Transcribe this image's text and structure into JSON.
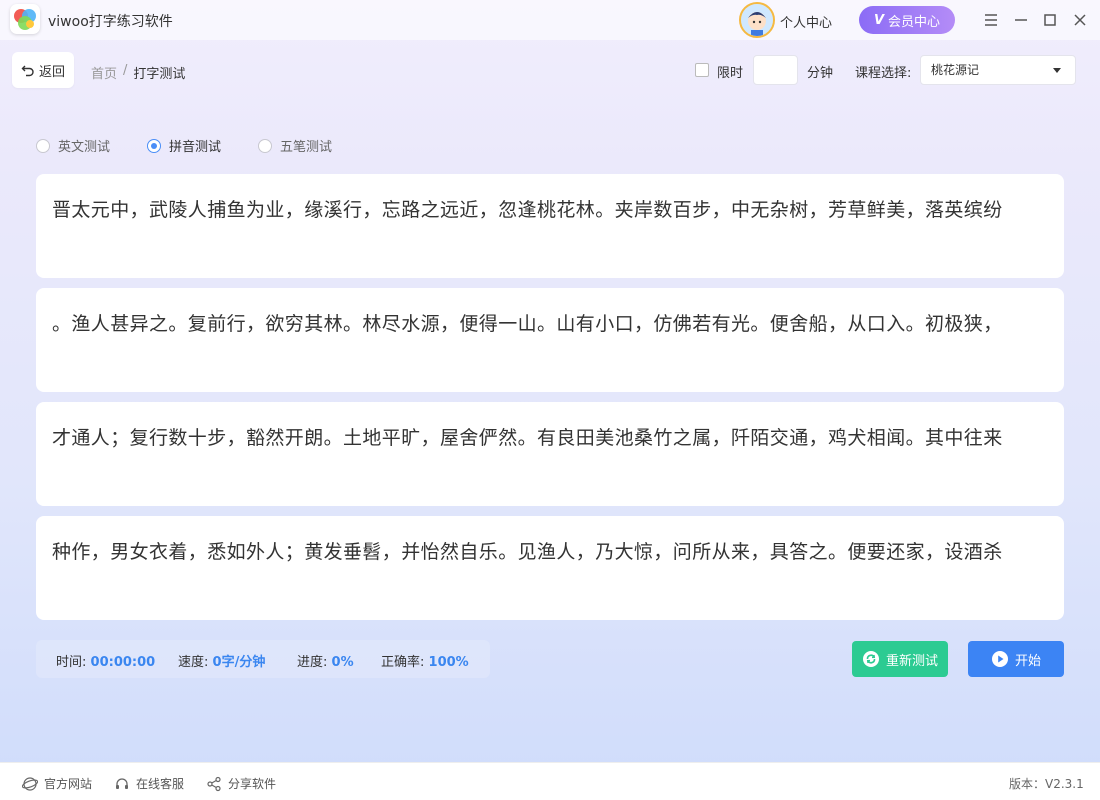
{
  "app": {
    "title": "viwoo打字练习软件",
    "personal_center": "个人中心",
    "vip_badge": "V",
    "vip_label": "会员中心"
  },
  "toolbar": {
    "back_label": "返回",
    "breadcrumb": {
      "home": "首页",
      "separator": "/",
      "current": "打字测试"
    },
    "time_limit_label": "限时",
    "time_limit_checked": false,
    "minutes_value": "",
    "minutes_unit": "分钟",
    "course_label": "课程选择:",
    "course_selected": "桃花源记"
  },
  "modes": [
    {
      "label": "英文测试",
      "selected": false
    },
    {
      "label": "拼音测试",
      "selected": true
    },
    {
      "label": "五笔测试",
      "selected": false
    }
  ],
  "lines": [
    "晋太元中，武陵人捕鱼为业，缘溪行，忘路之远近，忽逢桃花林。夹岸数百步，中无杂树，芳草鲜美，落英缤纷",
    "。渔人甚异之。复前行，欲穷其林。林尽水源，便得一山。山有小口，仿佛若有光。便舍船，从口入。初极狭，",
    "才通人；复行数十步，豁然开朗。土地平旷，屋舍俨然。有良田美池桑竹之属，阡陌交通，鸡犬相闻。其中往来",
    "种作，男女衣着，悉如外人；黄发垂髫，并怡然自乐。见渔人，乃大惊，问所从来，具答之。便要还家，设酒杀"
  ],
  "stats": {
    "time_label": "时间:",
    "time_value": "00:00:00",
    "speed_label": "速度:",
    "speed_value": "0字/分钟",
    "progress_label": "进度:",
    "progress_value": "0%",
    "accuracy_label": "正确率:",
    "accuracy_value": "100%"
  },
  "actions": {
    "retest_label": "重新测试",
    "start_label": "开始"
  },
  "footer": {
    "website": "官方网站",
    "service": "在线客服",
    "share": "分享软件",
    "version": "版本：V2.3.1"
  },
  "colors": {
    "accent_blue": "#3c84f4",
    "accent_green": "#2ccb92",
    "vip_purple": "#8b6cf6",
    "stat_value": "#3a86f0"
  }
}
